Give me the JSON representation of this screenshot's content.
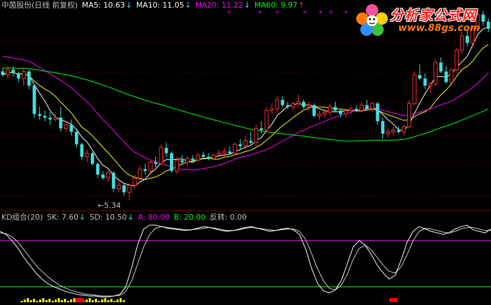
{
  "header": {
    "name": "中茵股份(日线 前复权)",
    "ma5": {
      "label": "MA5: 10.63",
      "arrow": "↓",
      "color": "#ffffff"
    },
    "ma10": {
      "label": "MA10: 11.05",
      "arrow": "↓",
      "color": "#ffff00"
    },
    "ma20": {
      "label": "MA20: 11.22",
      "arrow": "↓",
      "color": "#ff00ff"
    },
    "ma60": {
      "label": "MA60: 9.97",
      "arrow": "↑",
      "color": "#00ff00"
    }
  },
  "low_marker": "5.34",
  "kd_header": {
    "name": "KD组合(20)",
    "sk": {
      "label": "SK: 7.60",
      "arrow": "↓"
    },
    "sd": {
      "label": "SD: 10.50",
      "arrow": "↓"
    },
    "a": {
      "label": "A: 80.00",
      "color": "#ff00ff"
    },
    "b": {
      "label": "B: 20.00",
      "color": "#00ff00"
    },
    "reverse": {
      "label": "反转: 0.00",
      "color": "#c0c0c0"
    }
  },
  "logo": {
    "title": "分析家公式网",
    "url": "www.88gs.com"
  },
  "colors": {
    "up": "#ff3030",
    "down": "#40e0e0",
    "grid": "#800000",
    "ma5": "#ffffff",
    "ma10": "#ffff00",
    "ma20": "#ff00ff",
    "ma60": "#00ff00",
    "kd_sk": "#ffffff",
    "kd_sd": "#ffffff",
    "line_a": "#ff00ff",
    "line_b": "#00ff00"
  },
  "chart_data": [
    {
      "type": "candlestick",
      "title": "中茵股份(日线 前复权)",
      "ylim": [
        5.0,
        16.0
      ],
      "annotations": [
        {
          "text": "5.34",
          "x": 24,
          "note": "period low"
        }
      ],
      "candles": [
        {
          "o": 12.6,
          "h": 12.8,
          "l": 12.3,
          "c": 12.4
        },
        {
          "o": 12.4,
          "h": 12.9,
          "l": 12.2,
          "c": 12.7
        },
        {
          "o": 12.7,
          "h": 12.9,
          "l": 12.3,
          "c": 12.5
        },
        {
          "o": 12.5,
          "h": 12.6,
          "l": 12.0,
          "c": 12.2
        },
        {
          "o": 12.2,
          "h": 12.8,
          "l": 11.8,
          "c": 12.6
        },
        {
          "o": 12.6,
          "h": 12.7,
          "l": 11.6,
          "c": 11.8
        },
        {
          "o": 11.8,
          "h": 11.9,
          "l": 10.0,
          "c": 10.2
        },
        {
          "o": 10.2,
          "h": 10.6,
          "l": 9.9,
          "c": 10.1
        },
        {
          "o": 10.1,
          "h": 10.4,
          "l": 9.8,
          "c": 10.0
        },
        {
          "o": 10.0,
          "h": 10.3,
          "l": 9.6,
          "c": 9.9
        },
        {
          "o": 9.9,
          "h": 10.2,
          "l": 9.8,
          "c": 10.0
        },
        {
          "o": 10.0,
          "h": 10.6,
          "l": 9.2,
          "c": 9.4
        },
        {
          "o": 9.4,
          "h": 9.8,
          "l": 9.2,
          "c": 9.6
        },
        {
          "o": 9.6,
          "h": 9.9,
          "l": 9.0,
          "c": 9.2
        },
        {
          "o": 9.2,
          "h": 9.3,
          "l": 8.3,
          "c": 8.5
        },
        {
          "o": 8.5,
          "h": 8.6,
          "l": 7.6,
          "c": 7.8
        },
        {
          "o": 7.8,
          "h": 8.2,
          "l": 7.5,
          "c": 8.0
        },
        {
          "o": 8.0,
          "h": 8.1,
          "l": 7.3,
          "c": 7.4
        },
        {
          "o": 7.4,
          "h": 7.5,
          "l": 6.6,
          "c": 6.8
        },
        {
          "o": 6.8,
          "h": 7.0,
          "l": 6.5,
          "c": 6.6
        },
        {
          "o": 6.6,
          "h": 7.0,
          "l": 6.4,
          "c": 6.9
        },
        {
          "o": 6.9,
          "h": 7.0,
          "l": 5.8,
          "c": 6.0
        },
        {
          "o": 6.0,
          "h": 6.4,
          "l": 5.8,
          "c": 6.2
        },
        {
          "o": 6.2,
          "h": 6.3,
          "l": 5.6,
          "c": 5.8
        },
        {
          "o": 5.8,
          "h": 6.3,
          "l": 5.34,
          "c": 6.2
        },
        {
          "o": 6.2,
          "h": 6.8,
          "l": 6.0,
          "c": 6.6
        },
        {
          "o": 6.6,
          "h": 7.3,
          "l": 6.5,
          "c": 7.1
        },
        {
          "o": 7.1,
          "h": 7.4,
          "l": 6.8,
          "c": 7.0
        },
        {
          "o": 7.0,
          "h": 7.6,
          "l": 6.9,
          "c": 7.5
        },
        {
          "o": 7.5,
          "h": 7.8,
          "l": 7.2,
          "c": 7.4
        },
        {
          "o": 7.4,
          "h": 8.5,
          "l": 7.3,
          "c": 8.3
        },
        {
          "o": 8.3,
          "h": 8.6,
          "l": 7.8,
          "c": 8.0
        },
        {
          "o": 8.0,
          "h": 8.1,
          "l": 6.9,
          "c": 7.0
        },
        {
          "o": 7.0,
          "h": 7.8,
          "l": 6.8,
          "c": 7.6
        },
        {
          "o": 7.6,
          "h": 7.9,
          "l": 7.4,
          "c": 7.5
        },
        {
          "o": 7.5,
          "h": 7.8,
          "l": 7.3,
          "c": 7.7
        },
        {
          "o": 7.7,
          "h": 7.9,
          "l": 7.5,
          "c": 7.6
        },
        {
          "o": 7.6,
          "h": 8.0,
          "l": 7.5,
          "c": 7.9
        },
        {
          "o": 7.9,
          "h": 8.1,
          "l": 7.7,
          "c": 7.8
        },
        {
          "o": 7.8,
          "h": 8.0,
          "l": 7.6,
          "c": 7.7
        },
        {
          "o": 7.7,
          "h": 8.0,
          "l": 7.6,
          "c": 7.9
        },
        {
          "o": 7.9,
          "h": 8.2,
          "l": 7.8,
          "c": 8.0
        },
        {
          "o": 8.0,
          "h": 8.3,
          "l": 7.8,
          "c": 8.1
        },
        {
          "o": 8.1,
          "h": 8.4,
          "l": 7.9,
          "c": 8.0
        },
        {
          "o": 8.0,
          "h": 8.6,
          "l": 7.9,
          "c": 8.5
        },
        {
          "o": 8.5,
          "h": 8.8,
          "l": 8.2,
          "c": 8.4
        },
        {
          "o": 8.4,
          "h": 9.0,
          "l": 8.2,
          "c": 8.7
        },
        {
          "o": 8.7,
          "h": 9.2,
          "l": 8.5,
          "c": 8.6
        },
        {
          "o": 8.6,
          "h": 9.6,
          "l": 8.4,
          "c": 9.4
        },
        {
          "o": 9.4,
          "h": 9.8,
          "l": 9.1,
          "c": 9.3
        },
        {
          "o": 9.3,
          "h": 10.6,
          "l": 9.2,
          "c": 10.4
        },
        {
          "o": 10.4,
          "h": 10.8,
          "l": 10.2,
          "c": 10.5
        },
        {
          "o": 10.5,
          "h": 11.2,
          "l": 10.3,
          "c": 11.0
        },
        {
          "o": 11.0,
          "h": 11.2,
          "l": 10.6,
          "c": 10.7
        },
        {
          "o": 10.7,
          "h": 10.9,
          "l": 10.5,
          "c": 10.6
        },
        {
          "o": 10.6,
          "h": 10.9,
          "l": 10.4,
          "c": 10.8
        },
        {
          "o": 10.8,
          "h": 11.3,
          "l": 10.6,
          "c": 10.9
        },
        {
          "o": 10.9,
          "h": 11.0,
          "l": 10.5,
          "c": 10.6
        },
        {
          "o": 10.6,
          "h": 10.9,
          "l": 10.4,
          "c": 10.7
        },
        {
          "o": 10.7,
          "h": 10.8,
          "l": 10.0,
          "c": 10.1
        },
        {
          "o": 10.1,
          "h": 10.4,
          "l": 9.9,
          "c": 10.2
        },
        {
          "o": 10.2,
          "h": 10.5,
          "l": 10.0,
          "c": 10.3
        },
        {
          "o": 10.3,
          "h": 10.8,
          "l": 10.1,
          "c": 10.6
        },
        {
          "o": 10.6,
          "h": 10.9,
          "l": 10.3,
          "c": 10.4
        },
        {
          "o": 10.4,
          "h": 10.5,
          "l": 10.0,
          "c": 10.2
        },
        {
          "o": 10.2,
          "h": 10.5,
          "l": 10.0,
          "c": 10.4
        },
        {
          "o": 10.4,
          "h": 10.6,
          "l": 10.2,
          "c": 10.5
        },
        {
          "o": 10.5,
          "h": 10.7,
          "l": 10.3,
          "c": 10.4
        },
        {
          "o": 10.4,
          "h": 10.8,
          "l": 10.3,
          "c": 10.7
        },
        {
          "o": 10.7,
          "h": 11.0,
          "l": 10.4,
          "c": 10.5
        },
        {
          "o": 10.5,
          "h": 10.9,
          "l": 10.3,
          "c": 10.8
        },
        {
          "o": 10.8,
          "h": 10.9,
          "l": 9.6,
          "c": 9.8
        },
        {
          "o": 9.8,
          "h": 10.0,
          "l": 8.8,
          "c": 9.1
        },
        {
          "o": 9.1,
          "h": 9.4,
          "l": 8.9,
          "c": 9.2
        },
        {
          "o": 9.2,
          "h": 9.5,
          "l": 9.0,
          "c": 9.3
        },
        {
          "o": 9.3,
          "h": 9.5,
          "l": 9.1,
          "c": 9.2
        },
        {
          "o": 9.2,
          "h": 9.6,
          "l": 9.0,
          "c": 9.5
        },
        {
          "o": 9.5,
          "h": 11.0,
          "l": 9.4,
          "c": 10.8
        },
        {
          "o": 10.8,
          "h": 12.6,
          "l": 10.7,
          "c": 12.4
        },
        {
          "o": 12.4,
          "h": 13.0,
          "l": 12.1,
          "c": 12.2
        },
        {
          "o": 12.2,
          "h": 12.5,
          "l": 11.6,
          "c": 11.8
        },
        {
          "o": 11.8,
          "h": 12.0,
          "l": 11.4,
          "c": 11.9
        },
        {
          "o": 11.9,
          "h": 13.3,
          "l": 11.8,
          "c": 13.1
        },
        {
          "o": 13.1,
          "h": 13.4,
          "l": 12.5,
          "c": 12.6
        },
        {
          "o": 12.6,
          "h": 12.9,
          "l": 11.9,
          "c": 12.0
        },
        {
          "o": 12.0,
          "h": 12.8,
          "l": 11.8,
          "c": 12.7
        },
        {
          "o": 12.7,
          "h": 13.9,
          "l": 12.6,
          "c": 13.8
        },
        {
          "o": 13.8,
          "h": 14.8,
          "l": 13.6,
          "c": 14.6
        },
        {
          "o": 14.6,
          "h": 14.9,
          "l": 14.0,
          "c": 14.2
        },
        {
          "o": 14.2,
          "h": 15.2,
          "l": 14.1,
          "c": 15.0
        },
        {
          "o": 15.0,
          "h": 15.9,
          "l": 14.9,
          "c": 15.8
        },
        {
          "o": 15.8,
          "h": 16.0,
          "l": 15.2,
          "c": 15.4
        },
        {
          "o": 15.4,
          "h": 15.6,
          "l": 14.8,
          "c": 15.0
        }
      ]
    },
    {
      "type": "line",
      "title": "KD组合(20)",
      "ylim": [
        0,
        100
      ],
      "series": [
        {
          "name": "SK",
          "values": [
            92,
            88,
            80,
            70,
            58,
            48,
            38,
            30,
            24,
            20,
            17,
            14,
            12,
            10,
            9,
            8,
            8,
            7,
            7,
            8,
            10,
            20,
            45,
            75,
            95,
            100,
            100,
            98,
            96,
            95,
            94,
            93,
            94,
            96,
            98,
            97,
            95,
            93,
            92,
            93,
            95,
            97,
            98,
            96,
            94,
            92,
            93,
            95,
            96,
            94,
            88,
            70,
            45,
            25,
            15,
            12,
            16,
            28,
            50,
            72,
            80,
            74,
            62,
            48,
            38,
            30,
            35,
            55,
            78,
            92,
            98,
            95,
            92,
            90,
            88,
            90,
            95,
            98,
            100,
            94,
            92,
            90,
            95
          ]
        },
        {
          "name": "SD",
          "values": [
            90,
            89,
            85,
            78,
            68,
            58,
            48,
            40,
            33,
            27,
            22,
            18,
            15,
            13,
            11,
            10,
            9,
            8,
            8,
            8,
            9,
            14,
            28,
            50,
            72,
            88,
            96,
            98,
            97,
            96,
            95,
            94,
            94,
            95,
            96,
            97,
            96,
            94,
            93,
            93,
            94,
            96,
            97,
            96,
            95,
            94,
            93,
            94,
            95,
            95,
            92,
            82,
            64,
            44,
            28,
            18,
            16,
            22,
            36,
            56,
            70,
            74,
            68,
            58,
            48,
            40,
            38,
            46,
            62,
            80,
            92,
            96,
            95,
            93,
            91,
            90,
            92,
            95,
            97,
            97,
            95,
            93,
            93
          ]
        },
        {
          "name": "A",
          "values": [
            80
          ]
        },
        {
          "name": "B",
          "values": [
            20
          ]
        }
      ],
      "markers": [
        {
          "x": 21,
          "color": "#ff0000"
        },
        {
          "x": 106,
          "color": "#ff0000"
        }
      ]
    }
  ]
}
